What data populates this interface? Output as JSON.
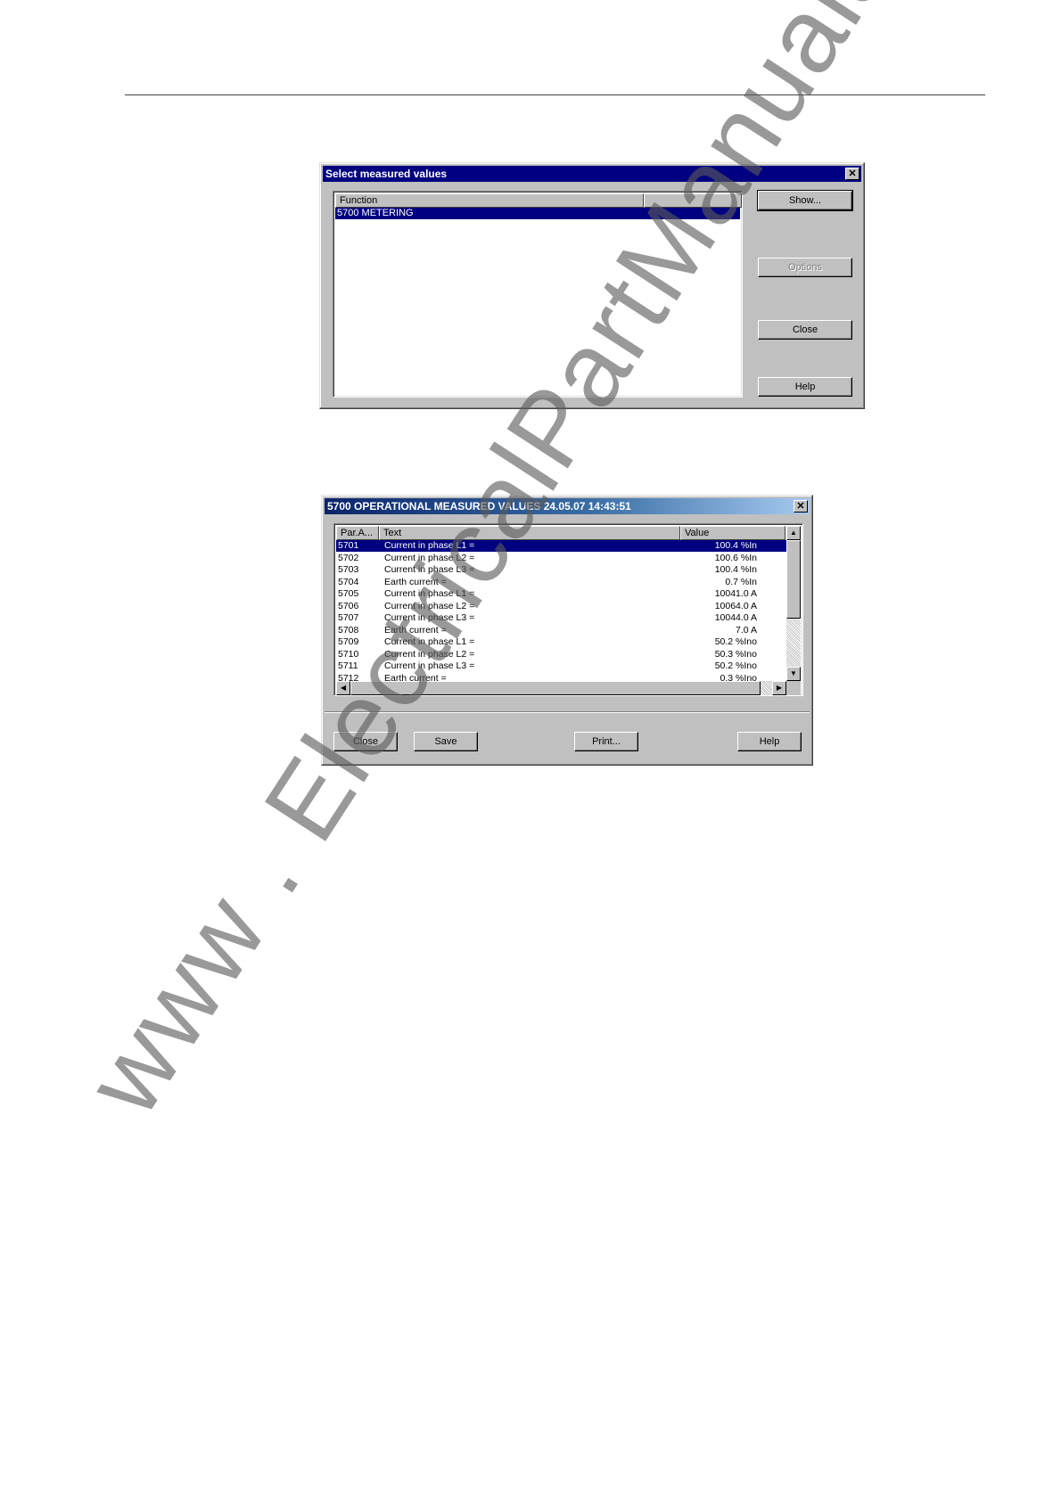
{
  "dialog1": {
    "title": "Select measured values",
    "close_glyph": "✕",
    "list": {
      "column_header": "Function",
      "column2_header": "",
      "items": [
        {
          "label": "5700  METERING",
          "selected": true
        }
      ]
    },
    "buttons": {
      "show": "Show...",
      "options": "Options",
      "close": "Close",
      "help": "Help"
    }
  },
  "dialog2": {
    "title": "5700  OPERATIONAL MEASURED VALUES 24.05.07 14:43:51",
    "close_glyph": "✕",
    "table": {
      "headers": {
        "param": "Par.A...",
        "text": "Text",
        "value": "Value"
      },
      "rows": [
        {
          "param": "5701",
          "text": "Current in phase L1 =",
          "value": "100.4 %In",
          "selected": true
        },
        {
          "param": "5702",
          "text": "Current in phase L2 =",
          "value": "100.6 %In"
        },
        {
          "param": "5703",
          "text": "Current in phase L3 =",
          "value": "100.4 %In"
        },
        {
          "param": "5704",
          "text": "Earth current =",
          "value": "0.7 %In"
        },
        {
          "param": "5705",
          "text": "Current in phase L1 =",
          "value": "10041.0 A"
        },
        {
          "param": "5706",
          "text": "Current in phase L2 =",
          "value": "10064.0 A"
        },
        {
          "param": "5707",
          "text": "Current in phase L3 =",
          "value": "10044.0 A"
        },
        {
          "param": "5708",
          "text": "Earth current =",
          "value": "7.0 A"
        },
        {
          "param": "5709",
          "text": "Current in phase L1 =",
          "value": "50.2 %Ino"
        },
        {
          "param": "5710",
          "text": "Current in phase L2 =",
          "value": "50.3 %Ino"
        },
        {
          "param": "5711",
          "text": "Current in phase L3 =",
          "value": "50.2 %Ino"
        },
        {
          "param": "5712",
          "text": "Earth current =",
          "value": "0.3 %Ino"
        }
      ]
    },
    "scroll_glyphs": {
      "up": "▲",
      "down": "▼",
      "left": "◀",
      "right": "▶"
    },
    "buttons": {
      "close": "Close",
      "save": "Save",
      "print": "Print...",
      "help": "Help"
    }
  },
  "watermark": "www . ElectricalPartManuals . com"
}
